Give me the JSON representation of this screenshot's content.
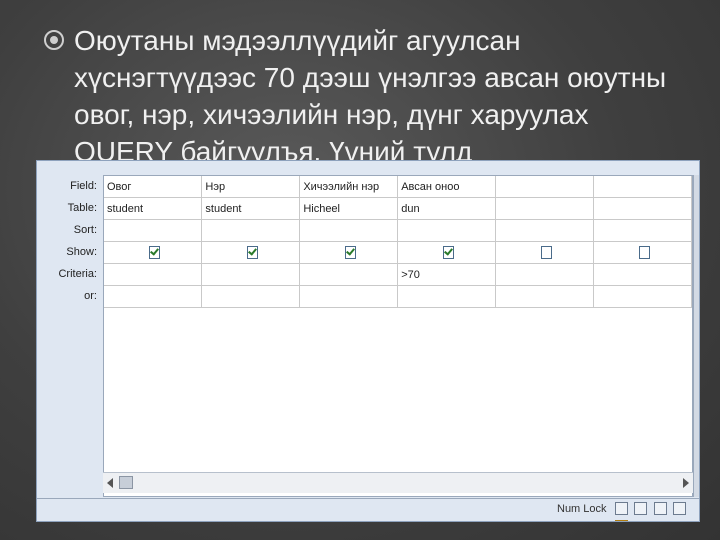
{
  "slide": {
    "bullet_text": "Оюутаны мэдээллүүдийг агуулсан хүснэгтүүдээс 70 дээш үнэлгээ авсан оюутны овог, нэр, хичээлийн нэр, дүнг харуулах QUERY байгуулъя. Үүний тулд"
  },
  "query_grid": {
    "row_labels": [
      "Field:",
      "Table:",
      "Sort:",
      "Show:",
      "Criteria:",
      "or:"
    ],
    "columns": [
      {
        "field": "Овог",
        "table": "student",
        "sort": "",
        "show": true,
        "criteria": "",
        "or": ""
      },
      {
        "field": "Нэр",
        "table": "student",
        "sort": "",
        "show": true,
        "criteria": "",
        "or": ""
      },
      {
        "field": "Хичээлийн нэр",
        "table": "Hicheel",
        "sort": "",
        "show": true,
        "criteria": "",
        "or": ""
      },
      {
        "field": "Авсан оноо",
        "table": "dun",
        "sort": "",
        "show": true,
        "criteria": ">70",
        "or": ""
      },
      {
        "field": "",
        "table": "",
        "sort": "",
        "show": false,
        "criteria": "",
        "or": ""
      },
      {
        "field": "",
        "table": "",
        "sort": "",
        "show": false,
        "criteria": "",
        "or": ""
      }
    ]
  },
  "status_bar": {
    "num_lock": "Num Lock",
    "view_buttons": [
      "datasheet-view-icon",
      "pivottable-view-icon",
      "pivotchart-view-icon",
      "sql-view-icon",
      "design-view-icon"
    ]
  }
}
